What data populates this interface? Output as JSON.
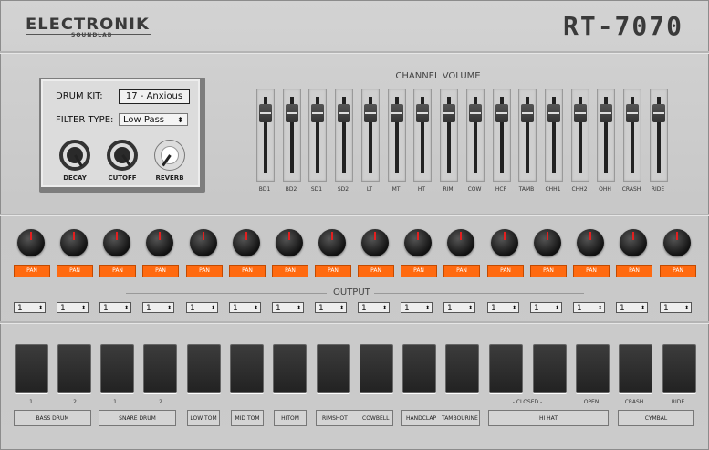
{
  "header": {
    "brand": "ELECTRONIK",
    "brand_sub": "SOUNDLAB",
    "model": "RT-7070"
  },
  "panel": {
    "drum_kit_label": "DRUM KIT:",
    "drum_kit_value": "17 - Anxious",
    "filter_type_label": "FILTER TYPE:",
    "filter_type_value": "Low Pass",
    "knobs": [
      "DECAY",
      "CUTOFF",
      "REVERB"
    ]
  },
  "channel_volume": {
    "title": "CHANNEL VOLUME",
    "channels": [
      "BD1",
      "BD2",
      "SD1",
      "SD2",
      "LT",
      "MT",
      "HT",
      "RIM",
      "COW",
      "HCP",
      "TAMB",
      "CHH1",
      "CHH2",
      "OHH",
      "CRASH",
      "RIDE"
    ]
  },
  "pan": {
    "label": "PAN",
    "count": 16
  },
  "output": {
    "title": "OUTPUT",
    "values": [
      "1",
      "1",
      "1",
      "1",
      "1",
      "1",
      "1",
      "1",
      "1",
      "1",
      "1",
      "1",
      "1",
      "1",
      "1",
      "1"
    ]
  },
  "pads": {
    "sub_labels": [
      "1",
      "2",
      "1",
      "2",
      "",
      "",
      "",
      "",
      "",
      "",
      "- CLOSED -",
      "",
      "OPEN",
      "CRASH",
      "RIDE"
    ],
    "groups": {
      "bass_drum": "BASS DRUM",
      "snare_drum": "SNARE DRUM",
      "low_tom": "LOW TOM",
      "mid_tom": "MID TOM",
      "hi_tom": "HITOM",
      "rimshot": "RIMSHOT",
      "cowbell": "COWBELL",
      "handclap": "HANDCLAP",
      "tambourine": "TAMBOURINE",
      "hi_hat": "HI HAT",
      "cymbal": "CYMBAL"
    }
  }
}
